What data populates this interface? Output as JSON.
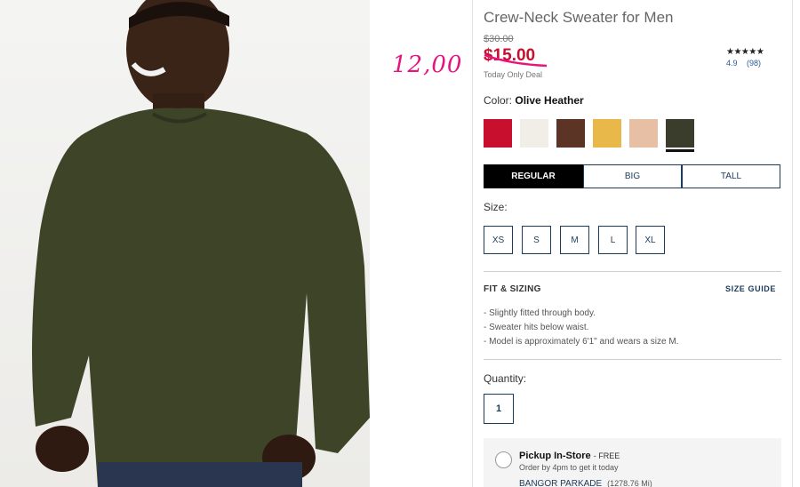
{
  "product": {
    "title": "Crew-Neck Sweater for Men",
    "original_price": "$30.00",
    "sale_price": "$15.00",
    "deal_text": "Today Only Deal",
    "handwritten_price": "12,00"
  },
  "rating": {
    "stars": "★★★★★",
    "score": "4.9",
    "count": "(98)"
  },
  "color": {
    "label": "Color:",
    "selected_name": "Olive Heather",
    "swatches": [
      {
        "name": "red",
        "hex": "#c8102e"
      },
      {
        "name": "ivory",
        "hex": "#f0eee6"
      },
      {
        "name": "brown",
        "hex": "#5c3426"
      },
      {
        "name": "mustard",
        "hex": "#e8b84a"
      },
      {
        "name": "blush",
        "hex": "#e6bfa5"
      },
      {
        "name": "olive",
        "hex": "#3a3d2b"
      }
    ]
  },
  "fit_tabs": [
    "REGULAR",
    "BIG",
    "TALL"
  ],
  "size": {
    "label": "Size:",
    "options": [
      "XS",
      "S",
      "M",
      "L",
      "XL"
    ]
  },
  "fit_sizing": {
    "heading": "FIT & SIZING",
    "guide_link": "SIZE GUIDE",
    "bullets": [
      "Slightly fitted through body.",
      "Sweater hits below waist.",
      "Model is approximately 6'1\" and wears a size M."
    ]
  },
  "quantity": {
    "label": "Quantity:",
    "value": "1"
  },
  "pickup": {
    "title": "Pickup In-Store",
    "free": "- FREE",
    "subtitle": "Order by 4pm to get it today",
    "store": "BANGOR PARKADE",
    "distance": "(1278.76 Mi)"
  }
}
